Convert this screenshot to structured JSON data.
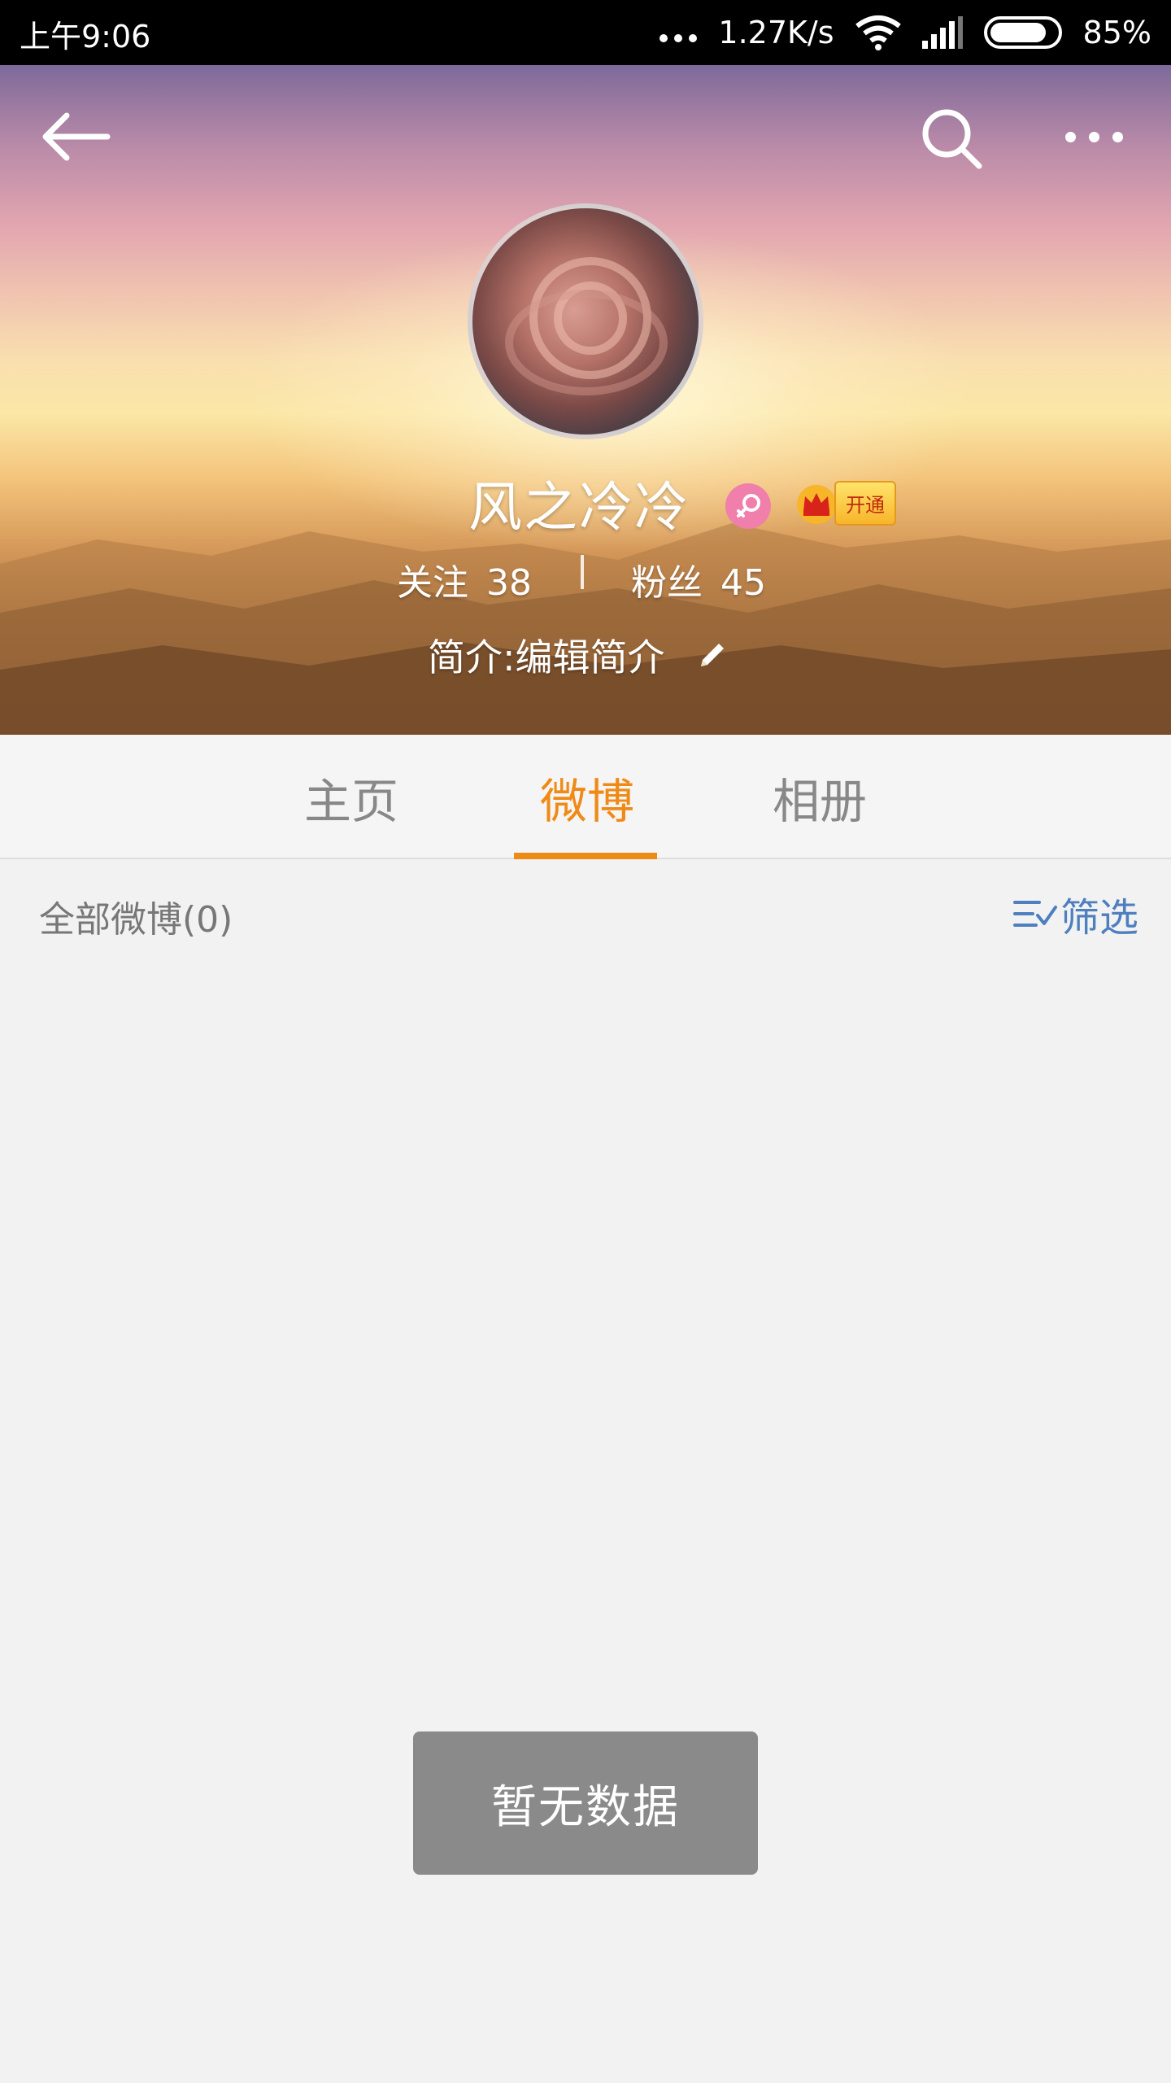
{
  "status_bar": {
    "time": "上午9:06",
    "net_speed": "1.27K/s",
    "battery": "85%",
    "battery_level": 0.85
  },
  "header": {
    "icons": [
      "back-arrow-icon",
      "search-icon",
      "more-icon"
    ],
    "username": "风之冷冷",
    "gender_badge": "female-icon",
    "vip_label": "开通",
    "follow_label": "关注",
    "follow_count": "38",
    "fans_label": "粉丝",
    "fans_count": "45",
    "intro": "简介:编辑简介",
    "intro_icon": "pencil-icon"
  },
  "tabs": [
    {
      "label": "主页",
      "active": false
    },
    {
      "label": "微博",
      "active": true
    },
    {
      "label": "相册",
      "active": false
    }
  ],
  "list": {
    "all_count": "全部微博(0)",
    "filter_label": "筛选",
    "filter_icon": "filter-list-icon"
  },
  "toast": {
    "text": "暂无数据"
  },
  "colors": {
    "accent": "#f08a16",
    "link": "#4e7fbf",
    "toast_bg": "#8a8a8a",
    "gender_badge": "#f07fab"
  }
}
